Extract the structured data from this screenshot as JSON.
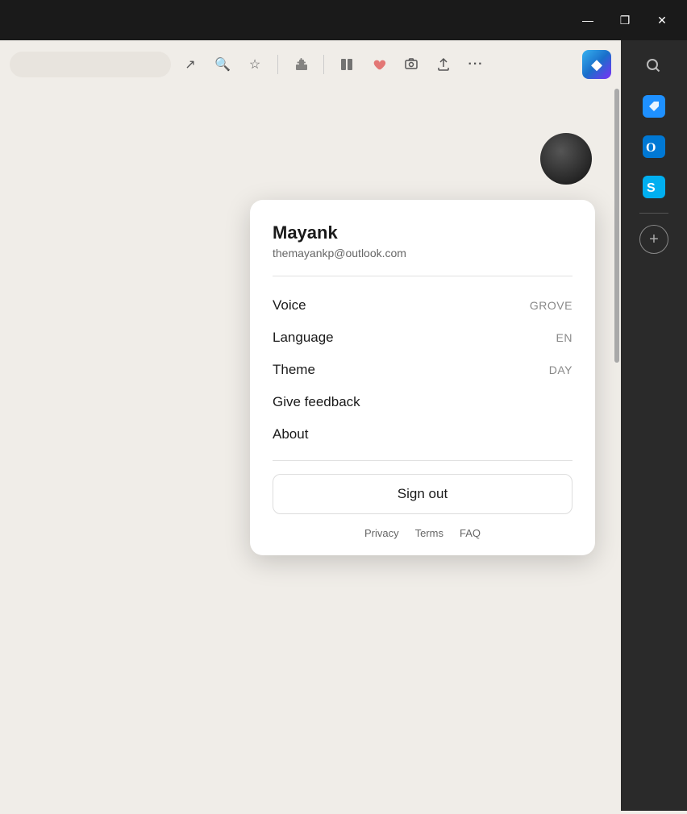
{
  "titleBar": {
    "minimizeLabel": "minimize",
    "restoreLabel": "restore",
    "closeLabel": "close",
    "minimizeIcon": "—",
    "restoreIcon": "❐",
    "closeIcon": "✕"
  },
  "toolbar": {
    "icons": [
      {
        "name": "external-link-icon",
        "symbol": "↗"
      },
      {
        "name": "zoom-out-icon",
        "symbol": "🔍"
      },
      {
        "name": "bookmark-icon",
        "symbol": "☆"
      }
    ],
    "separatorName": "toolbar-separator",
    "moreIcons": [
      {
        "name": "puzzle-icon",
        "symbol": "✦"
      },
      {
        "name": "reading-view-icon",
        "symbol": "⬚"
      },
      {
        "name": "health-icon",
        "symbol": "♡"
      },
      {
        "name": "screenshot-icon",
        "symbol": "⊞"
      },
      {
        "name": "share-icon",
        "symbol": "⬆"
      },
      {
        "name": "more-icon",
        "symbol": "•••"
      }
    ],
    "copilotIcon": {
      "name": "copilot-icon",
      "symbol": "◆"
    }
  },
  "sidebar": {
    "searchIcon": {
      "name": "search-icon",
      "symbol": "🔍"
    },
    "apps": [
      {
        "name": "sidebar-app-tags",
        "color": "#1e90ff",
        "symbol": "🏷"
      },
      {
        "name": "sidebar-app-outlook",
        "color": "#0078d4",
        "symbol": "📧"
      },
      {
        "name": "sidebar-app-skype",
        "color": "#00aff0",
        "symbol": "💬"
      }
    ],
    "addLabel": "+"
  },
  "profile": {
    "name": "Mayank",
    "email": "themayankp@outlook.com",
    "voiceLabel": "Voice",
    "voiceValue": "GROVE",
    "languageLabel": "Language",
    "languageValue": "EN",
    "themeLabel": "Theme",
    "themeValue": "DAY",
    "feedbackLabel": "Give feedback",
    "aboutLabel": "About",
    "signOutLabel": "Sign out",
    "footerLinks": [
      {
        "label": "Privacy",
        "name": "privacy-link"
      },
      {
        "label": "Terms",
        "name": "terms-link"
      },
      {
        "label": "FAQ",
        "name": "faq-link"
      }
    ]
  }
}
